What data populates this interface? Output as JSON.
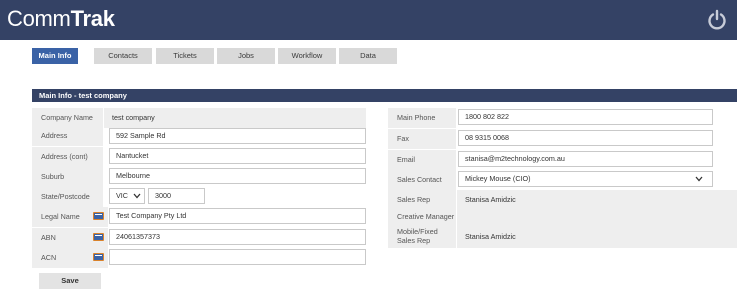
{
  "header": {
    "logo_part1": "Comm",
    "logo_part2": "Trak"
  },
  "tabs": [
    {
      "label": "Main Info",
      "active": true
    },
    {
      "label": "Contacts",
      "active": false
    },
    {
      "label": "Tickets",
      "active": false
    },
    {
      "label": "Jobs",
      "active": false
    },
    {
      "label": "Workflow",
      "active": false
    },
    {
      "label": "Data",
      "active": false
    }
  ],
  "panel": {
    "title": "Main Info - test company"
  },
  "left": {
    "company_name_label": "Company Name",
    "company_name_value": "test company",
    "address_label": "Address",
    "address_value": "592 Sample  Rd",
    "address_cont_label": "Address (cont)",
    "address_cont_value": "Nantucket",
    "suburb_label": "Suburb",
    "suburb_value": "Melbourne",
    "state_postcode_label": "State/Postcode",
    "state_value": "VIC",
    "postcode_value": "3000",
    "legal_name_label": "Legal Name",
    "legal_name_value": "Test Company Pty Ltd",
    "abn_label": "ABN",
    "abn_value": "24061357373",
    "acn_label": "ACN",
    "acn_value": ""
  },
  "right": {
    "main_phone_label": "Main Phone",
    "main_phone_value": "1800 802 822",
    "fax_label": "Fax",
    "fax_value": "08 9315 0068",
    "email_label": "Email",
    "email_value": "stanisa@m2technology.com.au",
    "sales_contact_label": "Sales Contact",
    "sales_contact_value": "Mickey Mouse (CIO)",
    "sales_rep_label": "Sales Rep",
    "sales_rep_value": "Stanisa Amidzic",
    "creative_manager_label": "Creative Manager",
    "creative_manager_value": "",
    "mobile_fixed_label": "Mobile/Fixed Sales Rep",
    "mobile_fixed_value": "Stanisa Amidzic"
  },
  "actions": {
    "save_label": "Save"
  },
  "colors": {
    "header_bg": "#344265",
    "tab_active": "#3a62a6",
    "tab_inactive": "#d9d9d9",
    "label_bg": "#eeeeee"
  },
  "icons": {
    "power": "power-icon",
    "abn_badge": "abn-lookup-icon",
    "dropdown": "chevron-down-icon"
  }
}
